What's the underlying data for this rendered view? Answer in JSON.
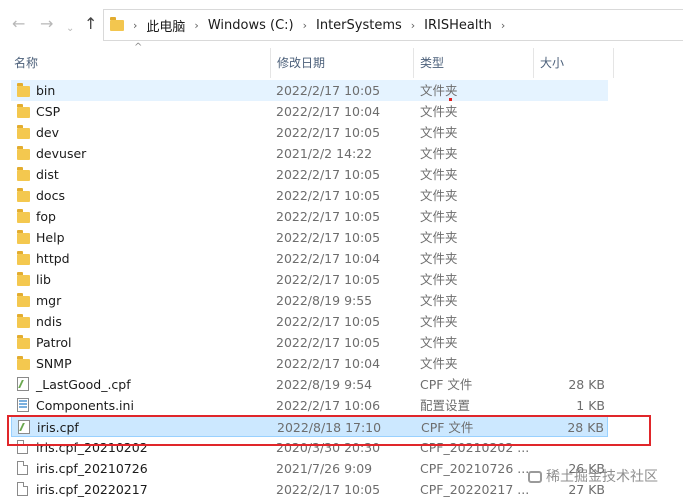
{
  "breadcrumbs": [
    "此电脑",
    "Windows (C:)",
    "InterSystems",
    "IRISHealth"
  ],
  "columns": {
    "name": "名称",
    "date": "修改日期",
    "type": "类型",
    "size": "大小"
  },
  "rows": [
    {
      "name": "bin",
      "date": "2022/2/17 10:05",
      "type": "文件夹",
      "size": "",
      "icon": "folder-icon",
      "state": "hover"
    },
    {
      "name": "CSP",
      "date": "2022/2/17 10:04",
      "type": "文件夹",
      "size": "",
      "icon": "folder-icon"
    },
    {
      "name": "dev",
      "date": "2022/2/17 10:05",
      "type": "文件夹",
      "size": "",
      "icon": "folder-icon"
    },
    {
      "name": "devuser",
      "date": "2021/2/2 14:22",
      "type": "文件夹",
      "size": "",
      "icon": "folder-icon"
    },
    {
      "name": "dist",
      "date": "2022/2/17 10:05",
      "type": "文件夹",
      "size": "",
      "icon": "folder-icon"
    },
    {
      "name": "docs",
      "date": "2022/2/17 10:05",
      "type": "文件夹",
      "size": "",
      "icon": "folder-icon"
    },
    {
      "name": "fop",
      "date": "2022/2/17 10:05",
      "type": "文件夹",
      "size": "",
      "icon": "folder-icon"
    },
    {
      "name": "Help",
      "date": "2022/2/17 10:05",
      "type": "文件夹",
      "size": "",
      "icon": "folder-icon"
    },
    {
      "name": "httpd",
      "date": "2022/2/17 10:04",
      "type": "文件夹",
      "size": "",
      "icon": "folder-icon"
    },
    {
      "name": "lib",
      "date": "2022/2/17 10:05",
      "type": "文件夹",
      "size": "",
      "icon": "folder-icon"
    },
    {
      "name": "mgr",
      "date": "2022/8/19 9:55",
      "type": "文件夹",
      "size": "",
      "icon": "folder-icon"
    },
    {
      "name": "ndis",
      "date": "2022/2/17 10:05",
      "type": "文件夹",
      "size": "",
      "icon": "folder-icon"
    },
    {
      "name": "Patrol",
      "date": "2022/2/17 10:05",
      "type": "文件夹",
      "size": "",
      "icon": "folder-icon"
    },
    {
      "name": "SNMP",
      "date": "2022/2/17 10:04",
      "type": "文件夹",
      "size": "",
      "icon": "folder-icon"
    },
    {
      "name": "_LastGood_.cpf",
      "date": "2022/8/19 9:54",
      "type": "CPF 文件",
      "size": "28 KB",
      "icon": "cpf-file-icon"
    },
    {
      "name": "Components.ini",
      "date": "2022/2/17 10:06",
      "type": "配置设置",
      "size": "1 KB",
      "icon": "settings-file-icon"
    },
    {
      "name": "iris.cpf",
      "date": "2022/8/18 17:10",
      "type": "CPF 文件",
      "size": "28 KB",
      "icon": "cpf-file-icon",
      "state": "selected"
    },
    {
      "name": "iris.cpf_20210202",
      "date": "2020/3/30 20:30",
      "type": "CPF_20210202 ...",
      "size": "",
      "icon": "file-icon"
    },
    {
      "name": "iris.cpf_20210726",
      "date": "2021/7/26 9:09",
      "type": "CPF_20210726 ...",
      "size": "26 KB",
      "icon": "file-icon"
    },
    {
      "name": "iris.cpf_20220217",
      "date": "2022/2/17 10:05",
      "type": "CPF_20220217 ...",
      "size": "27 KB",
      "icon": "file-icon"
    }
  ],
  "watermark": "稀土掘金技术社区"
}
